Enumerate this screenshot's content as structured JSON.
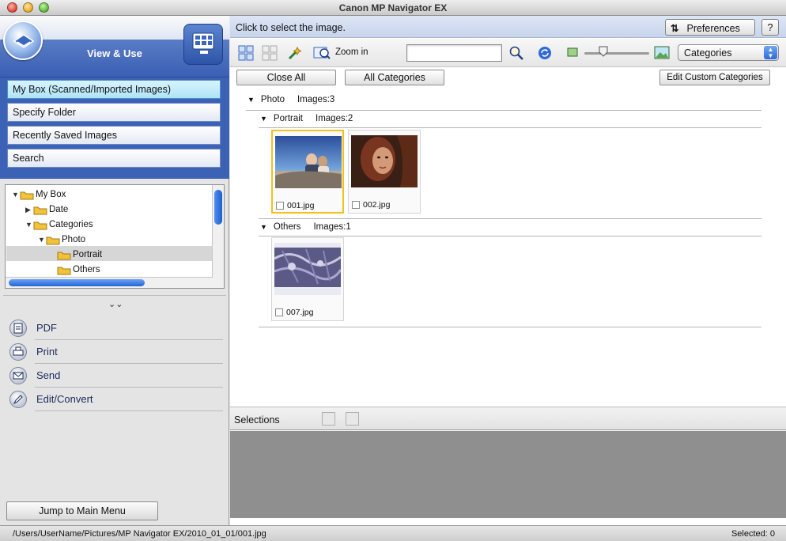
{
  "window": {
    "title": "Canon MP Navigator EX"
  },
  "left": {
    "mode_label": "View & Use",
    "nav": [
      {
        "label": "My Box (Scanned/Imported Images)",
        "active": true
      },
      {
        "label": "Specify Folder",
        "active": false
      },
      {
        "label": "Recently Saved Images",
        "active": false
      },
      {
        "label": "Search",
        "active": false
      }
    ],
    "tree": [
      {
        "label": "My Box"
      },
      {
        "label": "Date"
      },
      {
        "label": "Categories"
      },
      {
        "label": "Photo"
      },
      {
        "label": "Portrait"
      },
      {
        "label": "Others"
      }
    ],
    "actions": [
      {
        "label": "PDF",
        "icon": "pdf-icon"
      },
      {
        "label": "Print",
        "icon": "print-icon"
      },
      {
        "label": "Send",
        "icon": "send-icon"
      },
      {
        "label": "Edit/Convert",
        "icon": "edit-convert-icon"
      }
    ],
    "jump_label": "Jump to Main Menu"
  },
  "right": {
    "hint": "Click to select the image.",
    "preferences_label": "Preferences",
    "help_label": "?",
    "toolbar": {
      "zoom_label": "Zoom in",
      "search_value": "",
      "view_select": "Categories"
    },
    "buttons": {
      "close_all": "Close All",
      "all_categories": "All Categories",
      "edit_custom": "Edit Custom Categories"
    },
    "groups": {
      "photo": {
        "label": "Photo",
        "count": "Images:3"
      },
      "portrait": {
        "label": "Portrait",
        "count": "Images:2"
      },
      "others": {
        "label": "Others",
        "count": "Images:1"
      }
    },
    "thumbnails": [
      {
        "name": "001.jpg",
        "selected": true
      },
      {
        "name": "002.jpg",
        "selected": false
      },
      {
        "name": "007.jpg",
        "selected": false
      }
    ],
    "selections_label": "Selections"
  },
  "status": {
    "path": "/Users/UserName/Pictures/MP Navigator EX/2010_01_01/001.jpg",
    "selected": "Selected: 0"
  },
  "colors": {
    "accent": "#3c62b6",
    "selection_border": "#f3c11b"
  }
}
